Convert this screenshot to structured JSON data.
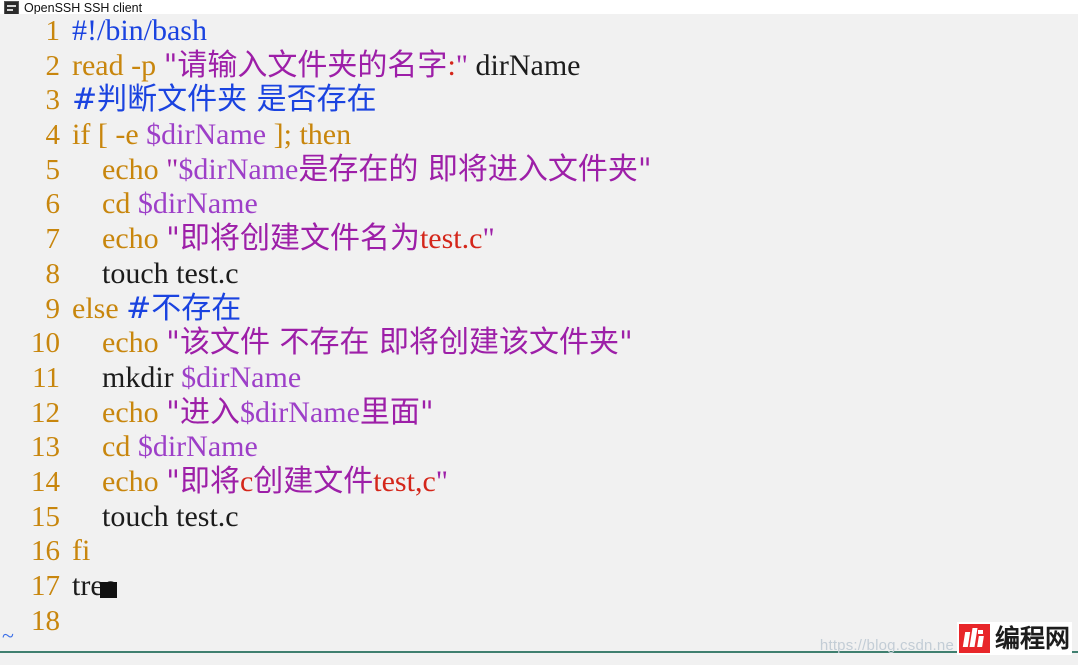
{
  "window": {
    "title": "OpenSSH SSH client",
    "icon": "terminal-icon"
  },
  "editor": {
    "empty_line_marker": "~",
    "cursor_line": 17,
    "lines": [
      {
        "num": "1",
        "segments": [
          {
            "text": "#!/bin/bash",
            "style": "cmt"
          }
        ]
      },
      {
        "num": "2",
        "segments": [
          {
            "text": "read ",
            "style": "kw"
          },
          {
            "text": "-p ",
            "style": "kw"
          },
          {
            "text": "\"请输入文件夹的名字",
            "style": "str"
          },
          {
            "text": ":",
            "style": "spec"
          },
          {
            "text": "\"",
            "style": "str"
          },
          {
            "text": " dirName",
            "style": "plain"
          }
        ]
      },
      {
        "num": "3",
        "segments": [
          {
            "text": "#判断文件夹 是否存在",
            "style": "cmt"
          }
        ]
      },
      {
        "num": "4",
        "segments": [
          {
            "text": "if ",
            "style": "kw"
          },
          {
            "text": "[ ",
            "style": "kw"
          },
          {
            "text": "-e ",
            "style": "kw"
          },
          {
            "text": "$dirName",
            "style": "var"
          },
          {
            "text": " ]",
            "style": "kw"
          },
          {
            "text": "; ",
            "style": "kw"
          },
          {
            "text": "then",
            "style": "kw"
          }
        ]
      },
      {
        "num": "5",
        "segments": [
          {
            "text": "    echo ",
            "style": "kw"
          },
          {
            "text": "\"",
            "style": "str"
          },
          {
            "text": "$dirName",
            "style": "var"
          },
          {
            "text": "是存在的 即将进入文件夹\"",
            "style": "str"
          }
        ]
      },
      {
        "num": "6",
        "segments": [
          {
            "text": "    cd ",
            "style": "kw"
          },
          {
            "text": "$dirName",
            "style": "var"
          }
        ]
      },
      {
        "num": "7",
        "segments": [
          {
            "text": "    echo ",
            "style": "kw"
          },
          {
            "text": "\"即将创建文件名为",
            "style": "str"
          },
          {
            "text": "test.c",
            "style": "spec"
          },
          {
            "text": "\"",
            "style": "str"
          }
        ]
      },
      {
        "num": "8",
        "segments": [
          {
            "text": "    touch test.c",
            "style": "plain"
          }
        ]
      },
      {
        "num": "9",
        "segments": [
          {
            "text": "else ",
            "style": "kw"
          },
          {
            "text": "#不存在",
            "style": "cmt"
          }
        ]
      },
      {
        "num": "10",
        "segments": [
          {
            "text": "    echo ",
            "style": "kw"
          },
          {
            "text": "\"该文件 不存在 即将创建该文件夹\"",
            "style": "str"
          }
        ]
      },
      {
        "num": "11",
        "segments": [
          {
            "text": "    mkdir ",
            "style": "plain"
          },
          {
            "text": "$dirName",
            "style": "var"
          }
        ]
      },
      {
        "num": "12",
        "segments": [
          {
            "text": "    echo ",
            "style": "kw"
          },
          {
            "text": "\"进入",
            "style": "str"
          },
          {
            "text": "$dirName",
            "style": "var"
          },
          {
            "text": "里面\"",
            "style": "str"
          }
        ]
      },
      {
        "num": "13",
        "segments": [
          {
            "text": "    cd ",
            "style": "kw"
          },
          {
            "text": "$dirName",
            "style": "var"
          }
        ]
      },
      {
        "num": "14",
        "segments": [
          {
            "text": "    echo ",
            "style": "kw"
          },
          {
            "text": "\"即将",
            "style": "str"
          },
          {
            "text": "c",
            "style": "spec"
          },
          {
            "text": "创建文件",
            "style": "str"
          },
          {
            "text": "test,c",
            "style": "spec"
          },
          {
            "text": "\"",
            "style": "str"
          }
        ]
      },
      {
        "num": "15",
        "segments": [
          {
            "text": "    touch test.c",
            "style": "plain"
          }
        ]
      },
      {
        "num": "16",
        "segments": [
          {
            "text": "fi",
            "style": "kw"
          }
        ]
      },
      {
        "num": "17",
        "segments": [
          {
            "text": "tree",
            "style": "plain"
          }
        ]
      },
      {
        "num": "18",
        "segments": [
          {
            "text": "",
            "style": "plain"
          }
        ]
      }
    ]
  },
  "watermark": {
    "url_text": "https://blog.csdn.ne"
  },
  "logo": {
    "mark": "biancheng-logo-icon",
    "text": "编程网"
  },
  "colors": {
    "background": "#f1f1f1",
    "line_number": "#c8860d",
    "keyword": "#c8860d",
    "comment": "#1a43e0",
    "string": "#9d1fa8",
    "variable": "#9d3fc8",
    "plain": "#1c1c1c",
    "special": "#d4261a",
    "status_border": "#3f7f6f",
    "logo_red": "#e8262a"
  }
}
